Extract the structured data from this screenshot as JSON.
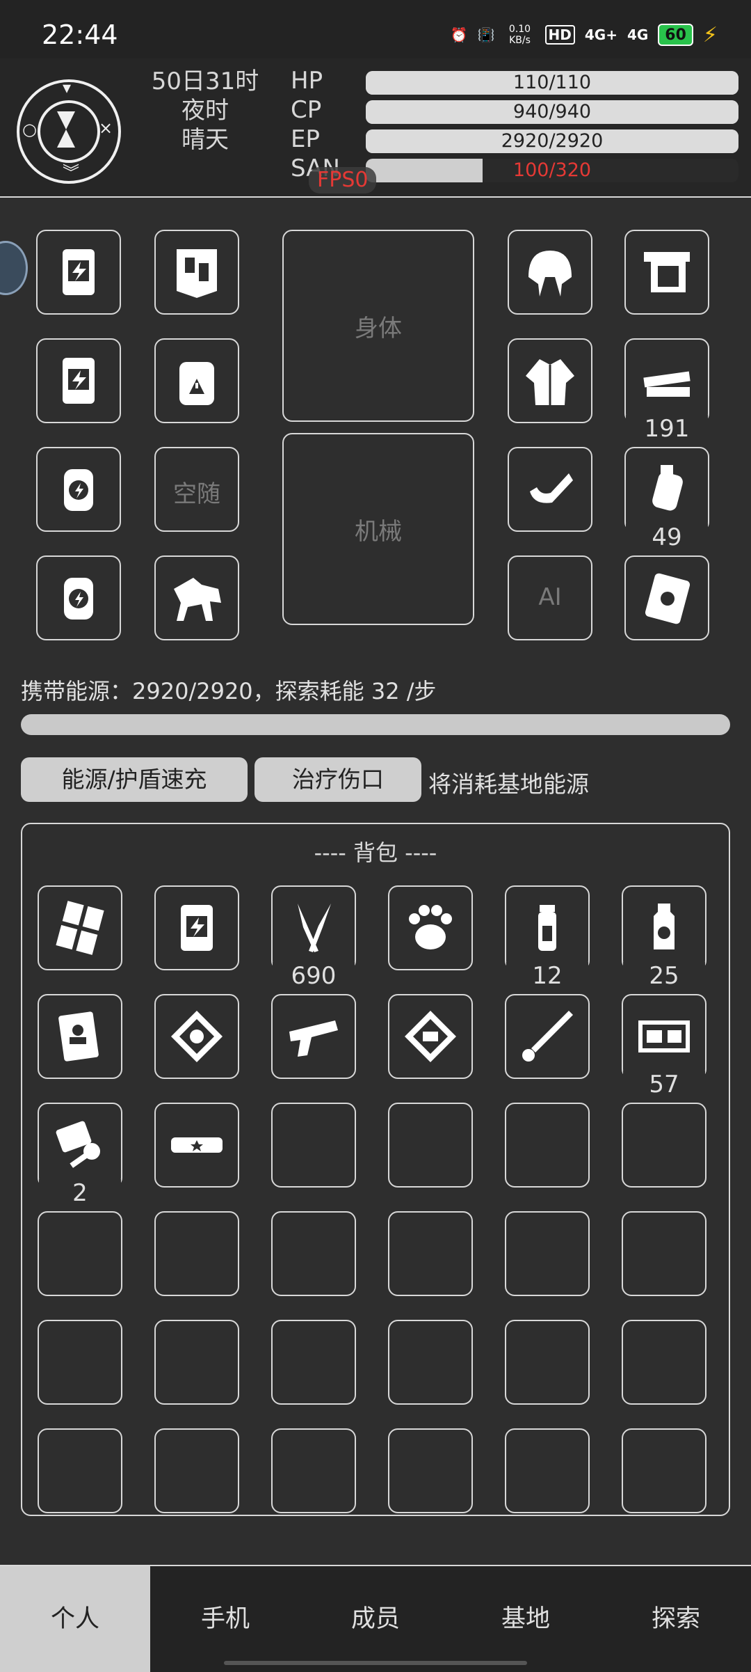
{
  "status_bar": {
    "time": "22:44",
    "net_speed": "0.10 KB/s",
    "hd": "HD",
    "sim1": "4G+",
    "sim2": "4G",
    "battery": "60"
  },
  "header": {
    "date": "50日31时",
    "period": "夜时",
    "weather": "晴天",
    "stats": [
      {
        "label": "HP",
        "value": "110/110",
        "fraction": 1.0
      },
      {
        "label": "CP",
        "value": "940/940",
        "fraction": 1.0
      },
      {
        "label": "EP",
        "value": "2920/2920",
        "fraction": 1.0
      },
      {
        "label": "SAN",
        "value": "100/320",
        "fraction": 0.3125
      }
    ],
    "fps_label": "FPS0"
  },
  "equipment": {
    "body_label": "身体",
    "mech_label": "机械",
    "follower_empty": "空随",
    "ai_label": "AI",
    "counts": {
      "ammo": "191",
      "grenade": "49"
    }
  },
  "energy": {
    "text": "携带能源：2920/2920，探索耗能 32 /步",
    "fraction": 1.0
  },
  "actions": {
    "recharge": "能源/护盾速充",
    "heal": "治疗伤口",
    "note": "将消耗基地能源"
  },
  "bag": {
    "title": "---- 背包 ----",
    "counts": {
      "knife": "690",
      "vial": "12",
      "bottle": "25",
      "ticket": "57",
      "keys": "2"
    }
  },
  "nav": {
    "tabs": [
      "个人",
      "手机",
      "成员",
      "基地",
      "探索"
    ],
    "active": 0
  },
  "colors": {
    "background": "#2e2e2e",
    "bar": "#c9c9c9",
    "warning": "#e53935",
    "battery": "#29c24b"
  }
}
